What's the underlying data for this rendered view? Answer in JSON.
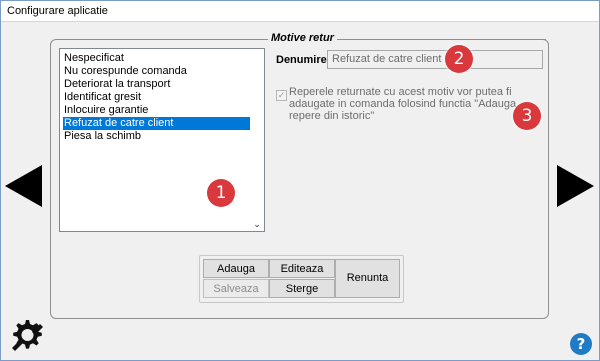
{
  "window": {
    "title": "Configurare aplicatie"
  },
  "group": {
    "title": "Motive retur"
  },
  "reasons_list": {
    "items": [
      "Nespecificat",
      "Nu corespunde comanda",
      "Deteriorat la transport",
      "Identificat gresit",
      "Inlocuire garantie",
      "Refuzat de catre client",
      "Piesa la schimb"
    ],
    "selected_index": 5,
    "scroll_down_glyph": "⌄"
  },
  "name_field": {
    "label": "Denumire:",
    "value": "Refuzat de catre client"
  },
  "history_checkbox": {
    "checked": true,
    "check_glyph": "✓",
    "label": "Reperele returnate cu acest motiv vor putea fi adaugate in comanda folosind functia \"Adauga repere din istoric\""
  },
  "buttons": {
    "add": "Adauga",
    "edit": "Editeaza",
    "save": "Salveaza",
    "delete": "Sterge",
    "cancel": "Renunta"
  },
  "markers": [
    "1",
    "2",
    "3"
  ],
  "icons": {
    "prev": "arrow-left-icon",
    "next": "arrow-right-icon",
    "settings": "gear-icon",
    "help": "help-icon"
  },
  "help_glyph": "?",
  "colors": {
    "selection": "#0078d7",
    "marker": "#d9393c",
    "help": "#1f7bc4"
  }
}
